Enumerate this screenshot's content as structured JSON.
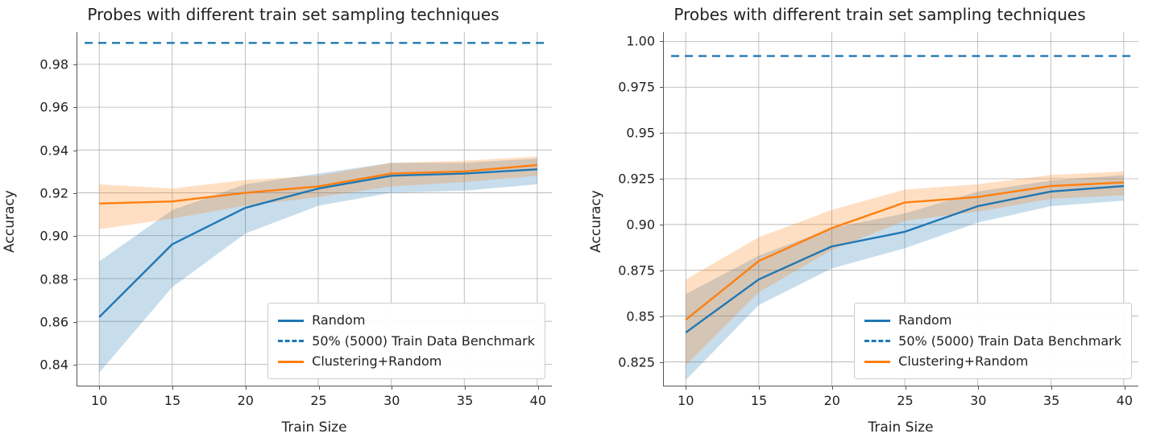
{
  "chart_data": [
    {
      "type": "line",
      "title": "Probes with different train set sampling techniques",
      "xlabel": "Train Size",
      "ylabel": "Accuracy",
      "xlim": [
        8.5,
        41
      ],
      "ylim": [
        0.83,
        0.995
      ],
      "xticks": [
        10,
        15,
        20,
        25,
        30,
        35,
        40
      ],
      "yticks": [
        0.84,
        0.86,
        0.88,
        0.9,
        0.92,
        0.94,
        0.96,
        0.98
      ],
      "x": [
        10,
        15,
        20,
        25,
        30,
        35,
        40
      ],
      "series": [
        {
          "name": "Random",
          "color": "#1f77b4",
          "style": "solid",
          "values": [
            0.862,
            0.896,
            0.913,
            0.922,
            0.928,
            0.929,
            0.931
          ],
          "band_low": [
            0.836,
            0.876,
            0.901,
            0.914,
            0.92,
            0.921,
            0.924
          ],
          "band_high": [
            0.888,
            0.912,
            0.924,
            0.929,
            0.934,
            0.934,
            0.936
          ]
        },
        {
          "name": "50% (5000) Train Data Benchmark",
          "color": "#1f77b4",
          "style": "dashed",
          "constant": 0.99
        },
        {
          "name": "Clustering+Random",
          "color": "#ff7f0e",
          "style": "solid",
          "values": [
            0.915,
            0.916,
            0.92,
            0.923,
            0.929,
            0.93,
            0.933
          ],
          "band_low": [
            0.903,
            0.908,
            0.914,
            0.918,
            0.923,
            0.925,
            0.928
          ],
          "band_high": [
            0.924,
            0.922,
            0.926,
            0.928,
            0.934,
            0.935,
            0.937
          ]
        }
      ],
      "legend_loc": "lower-right"
    },
    {
      "type": "line",
      "title": "Probes with different train set sampling techniques",
      "xlabel": "Train Size",
      "ylabel": "Accuracy",
      "xlim": [
        8.5,
        41
      ],
      "ylim": [
        0.812,
        1.005
      ],
      "xticks": [
        10,
        15,
        20,
        25,
        30,
        35,
        40
      ],
      "yticks": [
        0.825,
        0.85,
        0.875,
        0.9,
        0.925,
        0.95,
        0.975,
        1.0
      ],
      "x": [
        10,
        15,
        20,
        25,
        30,
        35,
        40
      ],
      "series": [
        {
          "name": "Random",
          "color": "#1f77b4",
          "style": "solid",
          "values": [
            0.841,
            0.87,
            0.888,
            0.896,
            0.91,
            0.918,
            0.921
          ],
          "band_low": [
            0.815,
            0.856,
            0.876,
            0.887,
            0.901,
            0.91,
            0.913
          ],
          "band_high": [
            0.862,
            0.883,
            0.898,
            0.906,
            0.918,
            0.924,
            0.927
          ]
        },
        {
          "name": "50% (5000) Train Data Benchmark",
          "color": "#1f77b4",
          "style": "dashed",
          "constant": 0.992
        },
        {
          "name": "Clustering+Random",
          "color": "#ff7f0e",
          "style": "solid",
          "values": [
            0.848,
            0.88,
            0.898,
            0.912,
            0.915,
            0.921,
            0.923
          ],
          "band_low": [
            0.823,
            0.863,
            0.886,
            0.902,
            0.907,
            0.914,
            0.916
          ],
          "band_high": [
            0.87,
            0.893,
            0.908,
            0.919,
            0.922,
            0.927,
            0.929
          ]
        }
      ],
      "legend_loc": "lower-right"
    }
  ],
  "colors": {
    "grid": "#b0b0b0",
    "random": "#1f77b4",
    "random_fill": "rgba(31,119,180,0.25)",
    "cluster": "#ff7f0e",
    "cluster_fill": "rgba(255,127,14,0.25)"
  }
}
